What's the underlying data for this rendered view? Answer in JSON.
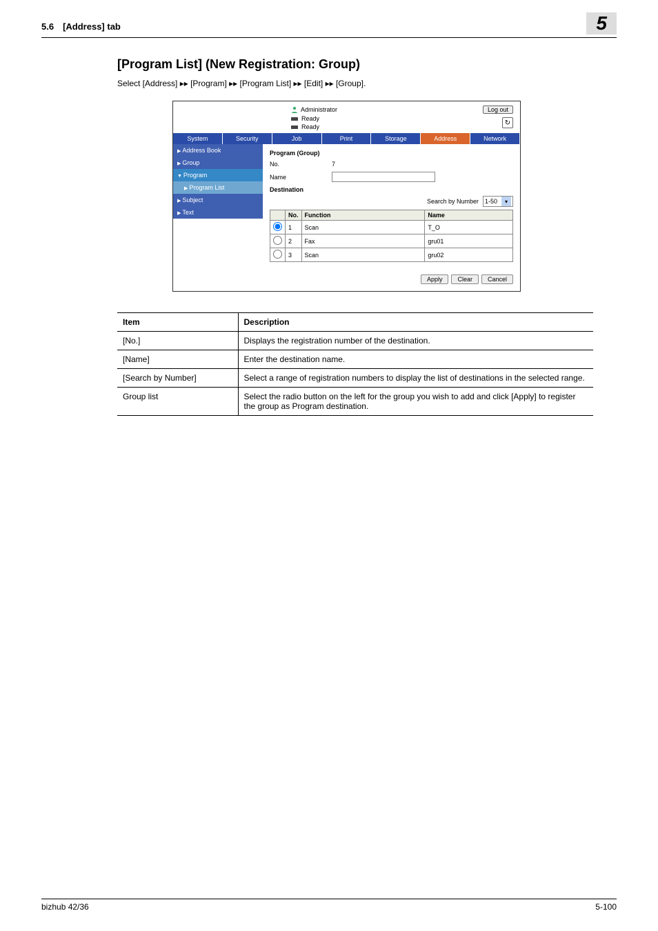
{
  "header": {
    "left": "5.6 [Address] tab",
    "right": "5"
  },
  "title": "[Program List] (New Registration: Group)",
  "description": "Select [Address] ▸▸ [Program] ▸▸ [Program List] ▸▸ [Edit] ▸▸ [Group].",
  "app": {
    "administrator": "Administrator",
    "logout": "Log out",
    "status1": "Ready",
    "status2": "Ready",
    "tabs": [
      "System",
      "Security",
      "Job",
      "Print",
      "Storage",
      "Address",
      "Network"
    ],
    "sidebar": [
      "Address Book",
      "Group",
      "Program",
      "Program List",
      "Subject",
      "Text"
    ],
    "form": {
      "title": "Program (Group)",
      "no_label": "No.",
      "no_value": "7",
      "name_label": "Name",
      "name_value": "",
      "dest_label": "Destination",
      "search_label": "Search by Number",
      "search_value": "1-50"
    },
    "table": {
      "cols": [
        "",
        "No.",
        "Function",
        "Name"
      ],
      "rows": [
        {
          "no": "1",
          "func": "Scan",
          "name": "T_O",
          "selected": true
        },
        {
          "no": "2",
          "func": "Fax",
          "name": "gru01",
          "selected": false
        },
        {
          "no": "3",
          "func": "Scan",
          "name": "gru02",
          "selected": false
        }
      ]
    },
    "buttons": {
      "apply": "Apply",
      "clear": "Clear",
      "cancel": "Cancel"
    }
  },
  "desc_table": {
    "headers": [
      "Item",
      "Description"
    ],
    "rows": [
      {
        "item": "[No.]",
        "desc": "Displays the registration number of the destination."
      },
      {
        "item": "[Name]",
        "desc": "Enter the destination name."
      },
      {
        "item": "[Search by Number]",
        "desc": "Select a range of registration numbers to display the list of destinations in the selected range."
      },
      {
        "item": "Group list",
        "desc": "Select the radio button on the left for the group you wish to add and click [Apply] to register the group as Program destination."
      }
    ]
  },
  "footer": {
    "left": "bizhub 42/36",
    "right": "5-100"
  }
}
